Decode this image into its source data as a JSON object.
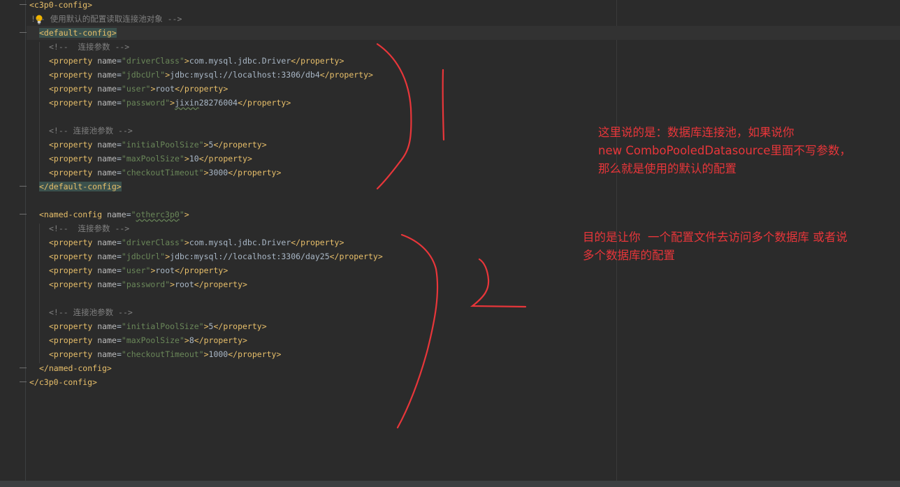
{
  "editor": {
    "lines": [
      {
        "tokens": [
          [
            "tag",
            "<c3p0-config>"
          ]
        ]
      },
      {
        "tokens": [
          [
            "cmt",
            "!-- 使用默认的配置读取连接池对象 -->"
          ]
        ]
      },
      {
        "tokens": [
          [
            "boxed",
            "<default-config>"
          ]
        ]
      },
      {
        "tokens": [
          [
            "cmt",
            "<!--  连接参数 -->"
          ]
        ]
      },
      {
        "tokens": [
          [
            "tag",
            "<property "
          ],
          [
            "attr",
            "name"
          ],
          [
            "eq",
            "="
          ],
          [
            "str",
            "\"driverClass\""
          ],
          [
            "tag",
            ">"
          ],
          [
            "txt",
            "com.mysql.jdbc.Driver"
          ],
          [
            "tag",
            "</property>"
          ]
        ]
      },
      {
        "tokens": [
          [
            "tag",
            "<property "
          ],
          [
            "attr",
            "name"
          ],
          [
            "eq",
            "="
          ],
          [
            "str",
            "\"jdbcUrl\""
          ],
          [
            "tag",
            ">"
          ],
          [
            "txt",
            "jdbc:mysql://localhost:3306/db4"
          ],
          [
            "tag",
            "</property>"
          ]
        ]
      },
      {
        "tokens": [
          [
            "tag",
            "<property "
          ],
          [
            "attr",
            "name"
          ],
          [
            "eq",
            "="
          ],
          [
            "str",
            "\"user\""
          ],
          [
            "tag",
            ">"
          ],
          [
            "txt",
            "root"
          ],
          [
            "tag",
            "</property>"
          ]
        ]
      },
      {
        "tokens": [
          [
            "tag",
            "<property "
          ],
          [
            "attr",
            "name"
          ],
          [
            "eq",
            "="
          ],
          [
            "str",
            "\"password\""
          ],
          [
            "tag",
            ">"
          ],
          [
            "typo",
            "jixin"
          ],
          [
            "txt",
            "28276004"
          ],
          [
            "tag",
            "</property>"
          ]
        ]
      },
      {
        "tokens": []
      },
      {
        "tokens": [
          [
            "cmt",
            "<!-- 连接池参数 -->"
          ]
        ]
      },
      {
        "tokens": [
          [
            "tag",
            "<property "
          ],
          [
            "attr",
            "name"
          ],
          [
            "eq",
            "="
          ],
          [
            "str",
            "\"initialPoolSize\""
          ],
          [
            "tag",
            ">"
          ],
          [
            "txt",
            "5"
          ],
          [
            "tag",
            "</property>"
          ]
        ]
      },
      {
        "tokens": [
          [
            "tag",
            "<property "
          ],
          [
            "attr",
            "name"
          ],
          [
            "eq",
            "="
          ],
          [
            "str",
            "\"maxPoolSize\""
          ],
          [
            "tag",
            ">"
          ],
          [
            "txt",
            "10"
          ],
          [
            "tag",
            "</property>"
          ]
        ]
      },
      {
        "tokens": [
          [
            "tag",
            "<property "
          ],
          [
            "attr",
            "name"
          ],
          [
            "eq",
            "="
          ],
          [
            "str",
            "\"checkoutTimeout\""
          ],
          [
            "tag",
            ">"
          ],
          [
            "txt",
            "3000"
          ],
          [
            "tag",
            "</property>"
          ]
        ]
      },
      {
        "tokens": [
          [
            "boxed",
            "</default-config>"
          ]
        ]
      },
      {
        "tokens": []
      },
      {
        "tokens": [
          [
            "tag",
            "<named-config "
          ],
          [
            "attr",
            "name"
          ],
          [
            "eq",
            "="
          ],
          [
            "str",
            "\""
          ],
          [
            "typostr",
            "otherc3p0"
          ],
          [
            "str",
            "\""
          ],
          [
            "tag",
            ">"
          ]
        ]
      },
      {
        "tokens": [
          [
            "cmt",
            "<!--  连接参数 -->"
          ]
        ]
      },
      {
        "tokens": [
          [
            "tag",
            "<property "
          ],
          [
            "attr",
            "name"
          ],
          [
            "eq",
            "="
          ],
          [
            "str",
            "\"driverClass\""
          ],
          [
            "tag",
            ">"
          ],
          [
            "txt",
            "com.mysql.jdbc.Driver"
          ],
          [
            "tag",
            "</property>"
          ]
        ]
      },
      {
        "tokens": [
          [
            "tag",
            "<property "
          ],
          [
            "attr",
            "name"
          ],
          [
            "eq",
            "="
          ],
          [
            "str",
            "\"jdbcUrl\""
          ],
          [
            "tag",
            ">"
          ],
          [
            "txt",
            "jdbc:mysql://localhost:3306/day25"
          ],
          [
            "tag",
            "</property>"
          ]
        ]
      },
      {
        "tokens": [
          [
            "tag",
            "<property "
          ],
          [
            "attr",
            "name"
          ],
          [
            "eq",
            "="
          ],
          [
            "str",
            "\"user\""
          ],
          [
            "tag",
            ">"
          ],
          [
            "txt",
            "root"
          ],
          [
            "tag",
            "</property>"
          ]
        ]
      },
      {
        "tokens": [
          [
            "tag",
            "<property "
          ],
          [
            "attr",
            "name"
          ],
          [
            "eq",
            "="
          ],
          [
            "str",
            "\"password\""
          ],
          [
            "tag",
            ">"
          ],
          [
            "txt",
            "root"
          ],
          [
            "tag",
            "</property>"
          ]
        ]
      },
      {
        "tokens": []
      },
      {
        "tokens": [
          [
            "cmt",
            "<!-- 连接池参数 -->"
          ]
        ]
      },
      {
        "tokens": [
          [
            "tag",
            "<property "
          ],
          [
            "attr",
            "name"
          ],
          [
            "eq",
            "="
          ],
          [
            "str",
            "\"initialPoolSize\""
          ],
          [
            "tag",
            ">"
          ],
          [
            "txt",
            "5"
          ],
          [
            "tag",
            "</property>"
          ]
        ]
      },
      {
        "tokens": [
          [
            "tag",
            "<property "
          ],
          [
            "attr",
            "name"
          ],
          [
            "eq",
            "="
          ],
          [
            "str",
            "\"maxPoolSize\""
          ],
          [
            "tag",
            ">"
          ],
          [
            "txt",
            "8"
          ],
          [
            "tag",
            "</property>"
          ]
        ]
      },
      {
        "tokens": [
          [
            "tag",
            "<property "
          ],
          [
            "attr",
            "name"
          ],
          [
            "eq",
            "="
          ],
          [
            "str",
            "\"checkoutTimeout\""
          ],
          [
            "tag",
            ">"
          ],
          [
            "txt",
            "1000"
          ],
          [
            "tag",
            "</property>"
          ]
        ]
      },
      {
        "tokens": [
          [
            "tag",
            "</named-config>"
          ]
        ]
      },
      {
        "tokens": [
          [
            "tag",
            "</c3p0-config>"
          ]
        ]
      }
    ]
  },
  "annotations": {
    "note1": "这里说的是：数据库连接池，如果说你\nnew ComboPooledDatasource里面不写参数，\n那么就是使用的默认的配置",
    "note2": "目的是让你  一个配置文件去访问多个数据库 或者说\n多个数据库的配置",
    "mark1": "1",
    "mark2": "2"
  },
  "colors": {
    "background": "#2b2b2b",
    "tag": "#e8bf6a",
    "string": "#6a8759",
    "comment": "#808080",
    "annotation": "#e8363a"
  }
}
